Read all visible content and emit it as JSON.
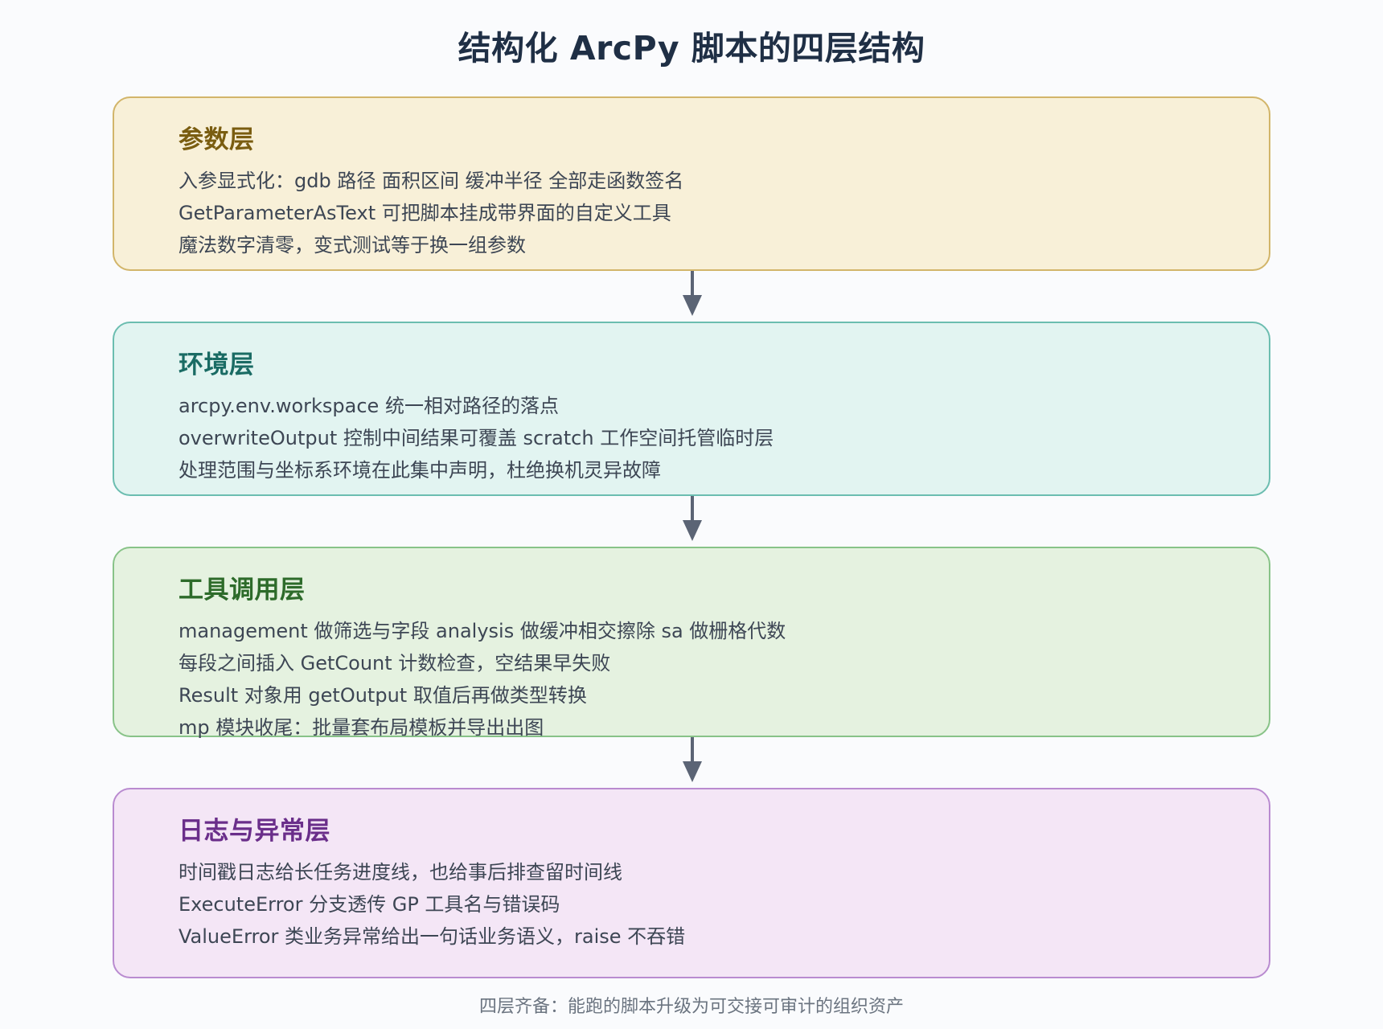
{
  "title": "结构化 ArcPy 脚本的四层结构",
  "layers": [
    {
      "title": "参数层",
      "lines": [
        "入参显式化：gdb 路径 面积区间 缓冲半径 全部走函数签名",
        "GetParameterAsText 可把脚本挂成带界面的自定义工具",
        "魔法数字清零，变式测试等于换一组参数"
      ],
      "bg": "#f8f0d8",
      "border": "#d2b56a",
      "title_color": "#7a5d10"
    },
    {
      "title": "环境层",
      "lines": [
        "arcpy.env.workspace 统一相对路径的落点",
        "overwriteOutput 控制中间结果可覆盖 scratch 工作空间托管临时层",
        "处理范围与坐标系环境在此集中声明，杜绝换机灵异故障"
      ],
      "bg": "#e2f4f1",
      "border": "#6bbdb0",
      "title_color": "#1a6b64"
    },
    {
      "title": "工具调用层",
      "lines": [
        "management 做筛选与字段 analysis 做缓冲相交擦除 sa 做栅格代数",
        "每段之间插入 GetCount 计数检查，空结果早失败",
        "Result 对象用 getOutput 取值后再做类型转换",
        "mp 模块收尾：批量套布局模板并导出出图"
      ],
      "bg": "#e5f2e0",
      "border": "#88c388",
      "title_color": "#2d6b2a"
    },
    {
      "title": "日志与异常层",
      "lines": [
        "时间戳日志给长任务进度线，也给事后排查留时间线",
        "ExecuteError 分支透传 GP 工具名与错误码",
        "ValueError 类业务异常给出一句话业务语义，raise 不吞错"
      ],
      "bg": "#f4e6f6",
      "border": "#b98bd0",
      "title_color": "#6a2e8a"
    }
  ],
  "footer": "四层齐备：能跑的脚本升级为可交接可审计的组织资产",
  "arrow_color": "#5b6475"
}
